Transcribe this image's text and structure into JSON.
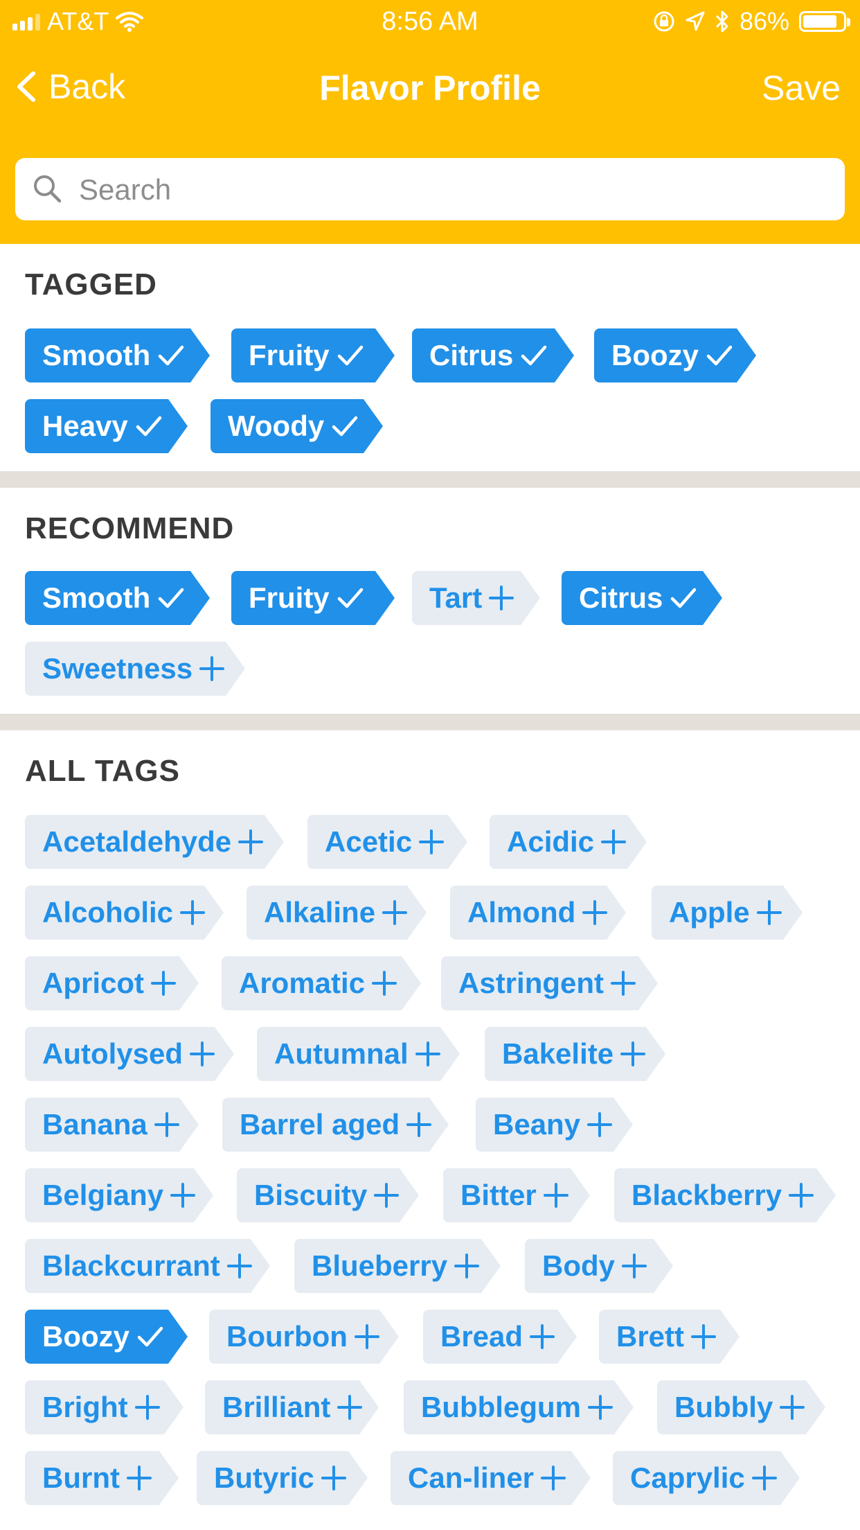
{
  "status_bar": {
    "carrier": "AT&T",
    "time": "8:56 AM",
    "battery": "86%",
    "battery_level": 0.86
  },
  "nav": {
    "back_label": "Back",
    "title": "Flavor Profile",
    "save_label": "Save"
  },
  "search": {
    "placeholder": "Search",
    "value": ""
  },
  "colors": {
    "header": "#FFC001",
    "tag_selected": "#2190E8",
    "tag_unselected_bg": "#E6ECF2",
    "divider": "#E5DFDA"
  },
  "icons": {
    "back": "chevron-left-icon",
    "search": "search-icon",
    "selected": "checkmark-icon",
    "unselected": "plus-icon"
  },
  "tagged": {
    "title": "TAGGED",
    "tags": [
      {
        "label": "Smooth",
        "selected": true
      },
      {
        "label": "Fruity",
        "selected": true
      },
      {
        "label": "Citrus",
        "selected": true
      },
      {
        "label": "Boozy",
        "selected": true
      },
      {
        "label": "Heavy",
        "selected": true
      },
      {
        "label": "Woody",
        "selected": true
      }
    ]
  },
  "recommend": {
    "title": "RECOMMEND",
    "tags": [
      {
        "label": "Smooth",
        "selected": true
      },
      {
        "label": "Fruity",
        "selected": true
      },
      {
        "label": "Tart",
        "selected": false
      },
      {
        "label": "Citrus",
        "selected": true
      },
      {
        "label": "Sweetness",
        "selected": false
      }
    ]
  },
  "all_tags": {
    "title": "ALL TAGS",
    "tags": [
      {
        "label": "Acetaldehyde",
        "selected": false
      },
      {
        "label": "Acetic",
        "selected": false
      },
      {
        "label": "Acidic",
        "selected": false
      },
      {
        "label": "Alcoholic",
        "selected": false
      },
      {
        "label": "Alkaline",
        "selected": false
      },
      {
        "label": "Almond",
        "selected": false
      },
      {
        "label": "Apple",
        "selected": false
      },
      {
        "label": "Apricot",
        "selected": false
      },
      {
        "label": "Aromatic",
        "selected": false
      },
      {
        "label": "Astringent",
        "selected": false
      },
      {
        "label": "Autolysed",
        "selected": false
      },
      {
        "label": "Autumnal",
        "selected": false
      },
      {
        "label": "Bakelite",
        "selected": false
      },
      {
        "label": "Banana",
        "selected": false
      },
      {
        "label": "Barrel aged",
        "selected": false
      },
      {
        "label": "Beany",
        "selected": false
      },
      {
        "label": "Belgiany",
        "selected": false
      },
      {
        "label": "Biscuity",
        "selected": false
      },
      {
        "label": "Bitter",
        "selected": false
      },
      {
        "label": "Blackberry",
        "selected": false
      },
      {
        "label": "Blackcurrant",
        "selected": false
      },
      {
        "label": "Blueberry",
        "selected": false
      },
      {
        "label": "Body",
        "selected": false
      },
      {
        "label": "Boozy",
        "selected": true
      },
      {
        "label": "Bourbon",
        "selected": false
      },
      {
        "label": "Bread",
        "selected": false
      },
      {
        "label": "Brett",
        "selected": false
      },
      {
        "label": "Bright",
        "selected": false
      },
      {
        "label": "Brilliant",
        "selected": false
      },
      {
        "label": "Bubblegum",
        "selected": false
      },
      {
        "label": "Bubbly",
        "selected": false
      },
      {
        "label": "Burnt",
        "selected": false
      },
      {
        "label": "Butyric",
        "selected": false
      },
      {
        "label": "Can-liner",
        "selected": false
      },
      {
        "label": "Caprylic",
        "selected": false
      }
    ]
  }
}
